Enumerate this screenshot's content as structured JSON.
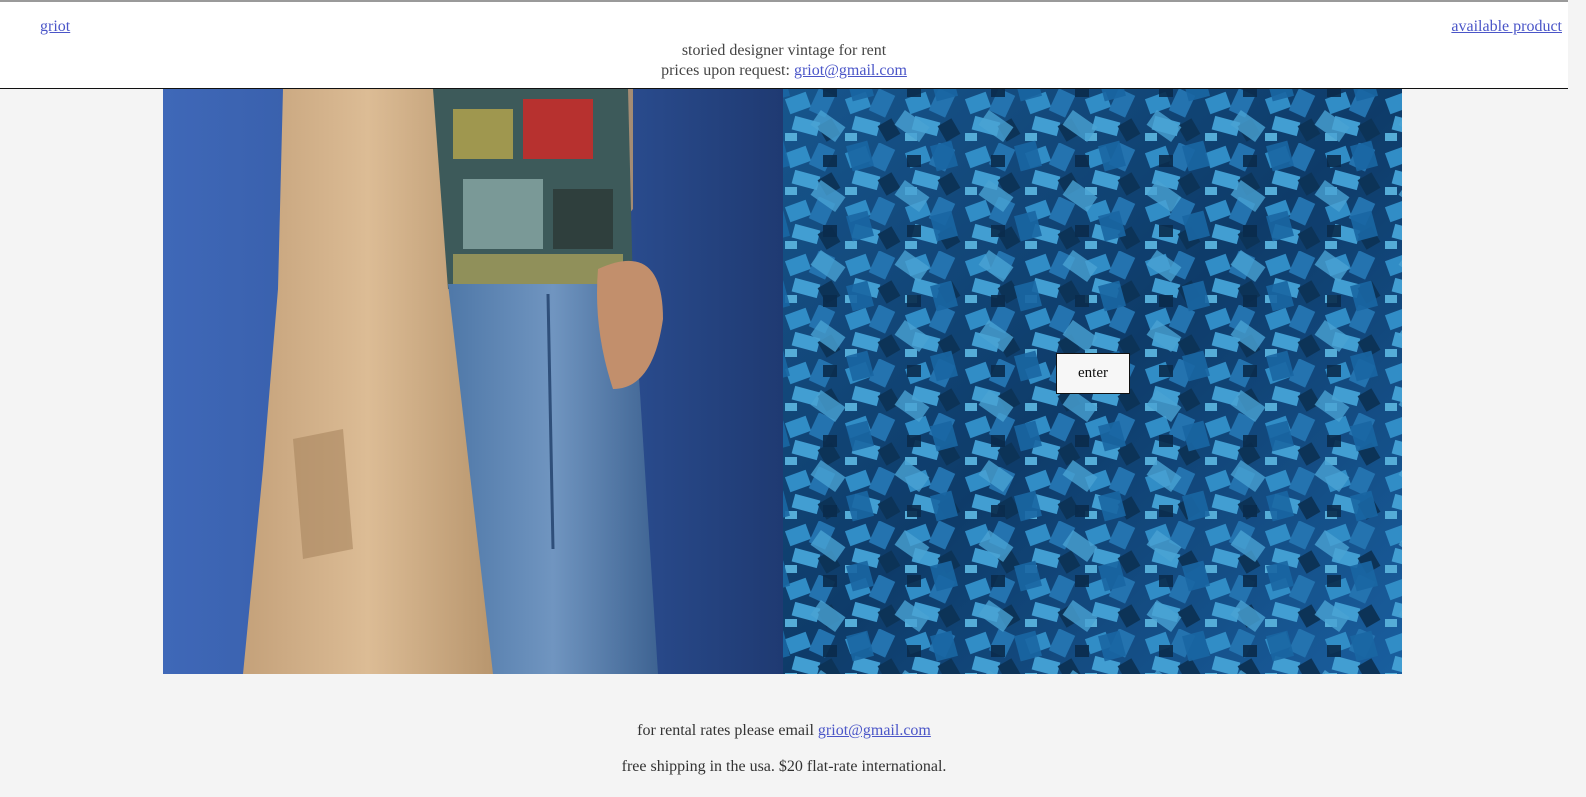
{
  "header": {
    "brand": "griot",
    "product_link": "available product",
    "tagline": "storied designer vintage for rent",
    "pricing_prefix": "prices upon request: ",
    "pricing_email": "griot@gmail.com"
  },
  "hero": {
    "enter_label": "enter",
    "left_image": "fashion-model-trench-coat-jeans-photo",
    "right_image": "blue-crystals-texture-photo"
  },
  "footer": {
    "rates_prefix": "for rental rates please email ",
    "rates_email": "griot@gmail.com",
    "shipping": "free shipping in the usa. $20 flat-rate international."
  },
  "colors": {
    "link": "#4a55c8",
    "background": "#f4f4f4",
    "hero_left_blue": "#3b63b0",
    "hero_right_blue": "#1f6fb0"
  }
}
